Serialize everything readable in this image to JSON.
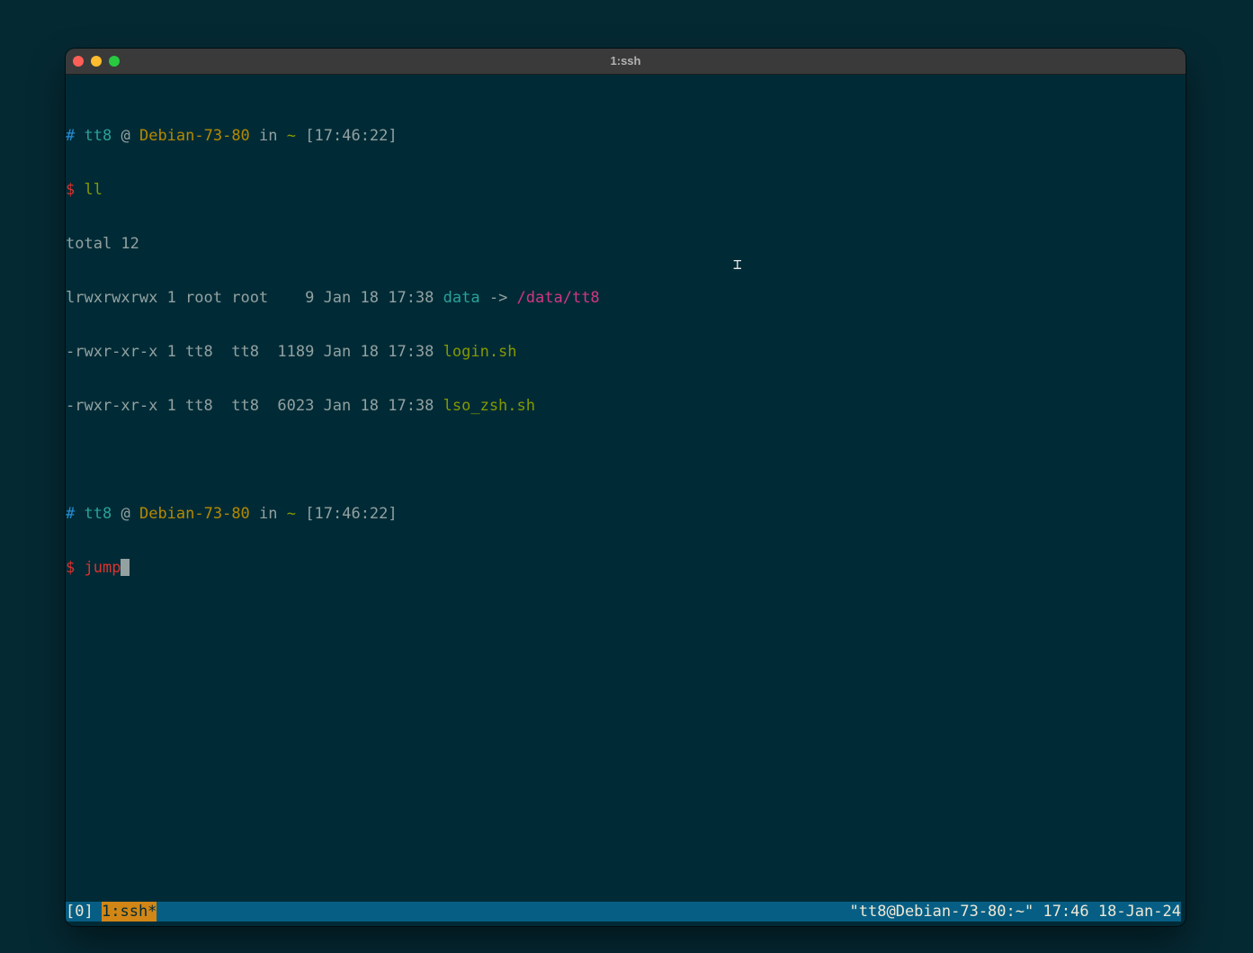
{
  "window": {
    "title": "1:ssh"
  },
  "terminal": {
    "prompt1": {
      "hash": "#",
      "user": "tt8",
      "at": "@",
      "host": "Debian-73-80",
      "in": "in",
      "dir": "~",
      "time": "[17:46:22]"
    },
    "cmd1": {
      "dollar": "$",
      "command": "ll"
    },
    "output": {
      "total": "total 12",
      "rows": [
        {
          "meta": "lrwxrwxrwx 1 root root    9 Jan 18 17:38 ",
          "name": "data",
          "arrow": " -> ",
          "target": "/data/tt8"
        },
        {
          "meta": "-rwxr-xr-x 1 tt8  tt8  1189 Jan 18 17:38 ",
          "name": "login.sh"
        },
        {
          "meta": "-rwxr-xr-x 1 tt8  tt8  6023 Jan 18 17:38 ",
          "name": "lso_zsh.sh"
        }
      ]
    },
    "prompt2": {
      "hash": "#",
      "user": "tt8",
      "at": "@",
      "host": "Debian-73-80",
      "in": "in",
      "dir": "~",
      "time": "[17:46:22]"
    },
    "cmd2": {
      "dollar": "$",
      "command": "jump"
    }
  },
  "tmux_status": {
    "session": "[0]",
    "window": "1:ssh*",
    "right": "\"tt8@Debian-73-80:~\" 17:46 18-Jan-24"
  },
  "colors": {
    "background": "#002b36",
    "status_bar": "#075e84",
    "active_window": "#d18616"
  }
}
